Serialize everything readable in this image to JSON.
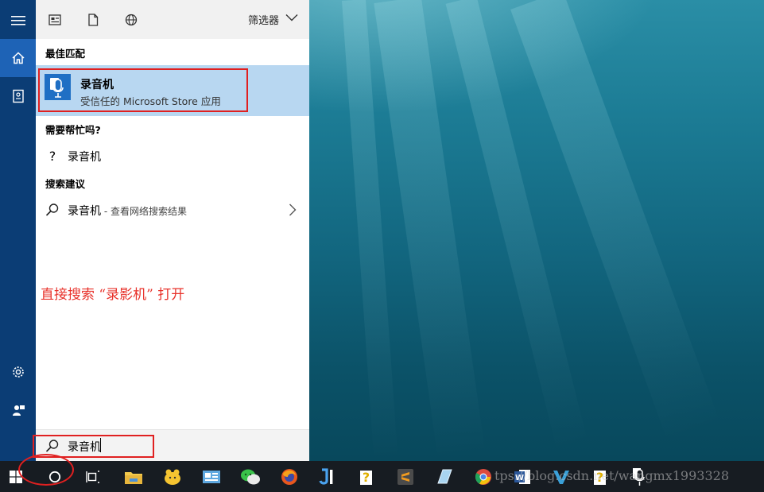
{
  "filter": {
    "label": "筛选器",
    "icons": [
      "apps-icon",
      "document-icon",
      "web-icon"
    ]
  },
  "rail": {
    "top_icons": [
      "menu-icon",
      "home-icon",
      "notebook-icon"
    ],
    "bottom_icons": [
      "settings-icon",
      "feedback-icon"
    ]
  },
  "best_match": {
    "section_title": "最佳匹配",
    "app_name": "录音机",
    "app_subtitle": "受信任的 Microsoft Store 应用"
  },
  "help": {
    "section_title": "需要帮忙吗?",
    "icon": "?",
    "item_text": "录音机"
  },
  "suggestions": {
    "section_title": "搜索建议",
    "item_text": "录音机",
    "item_sub": " - 查看网络搜索结果"
  },
  "annotation": "直接搜索 “录影机” 打开",
  "search": {
    "value": "录音机"
  },
  "taskbar": {
    "apps": [
      "windows-start-icon",
      "cortana-icon",
      "task-view-icon",
      "file-explorer-icon",
      "app-yellow-icon",
      "app-blue-icon",
      "wechat-icon",
      "firefox-icon",
      "jetbrains-icon",
      "help-app-icon",
      "sublime-icon",
      "notes-icon",
      "chrome-icon",
      "word-icon",
      "app-vm-icon",
      "help-app-2-icon",
      "voice-recorder-icon"
    ]
  },
  "watermark": "tps://blog.csdn.net/wangmx1993328",
  "colors": {
    "rail": "#0b3d75",
    "accent": "#1e63b6",
    "selection": "#b8d7f1",
    "annotation": "#e8322b",
    "taskbar": "#171c22"
  }
}
